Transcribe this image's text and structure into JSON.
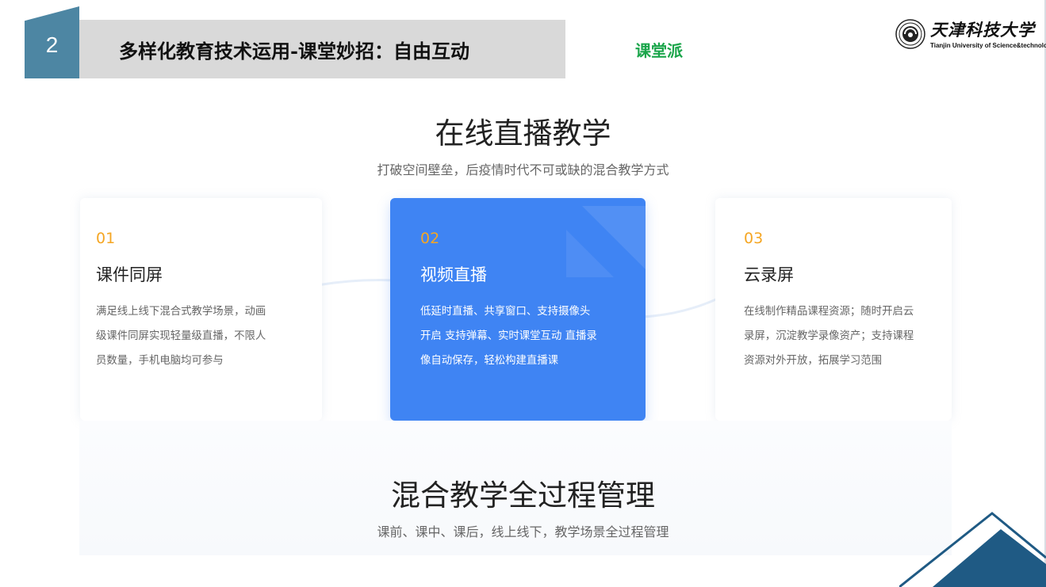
{
  "header": {
    "section_number": "2",
    "title": "多样化教育技术运用-课堂妙招：自由互动",
    "brand_tag": "课堂派"
  },
  "logo": {
    "name_cn": "天津科技大学",
    "name_en": "Tianjin University of Science&technology"
  },
  "section1": {
    "title": "在线直播教学",
    "subtitle": "打破空间壁垒，后疫情时代不可或缺的混合教学方式",
    "cards": [
      {
        "number": "01",
        "title": "课件同屏",
        "desc_lines": [
          "满足线上线下混合式教学场景，动画",
          "级课件同屏实现轻量级直播，不限人",
          "员数量，手机电脑均可参与"
        ]
      },
      {
        "number": "02",
        "title": "视频直播",
        "desc_lines": [
          "低延时直播、共享窗口、支持摄像头",
          "开启 支持弹幕、实时课堂互动 直播录",
          "像自动保存，轻松构建直播课"
        ]
      },
      {
        "number": "03",
        "title": "云录屏",
        "desc_lines": [
          "在线制作精品课程资源；随时开启云",
          "录屏，沉淀教学录像资产；支持课程",
          "资源对外开放，拓展学习范围"
        ]
      }
    ]
  },
  "section2": {
    "title": "混合教学全过程管理",
    "subtitle": "课前、课中、课后，线上线下，教学场景全过程管理"
  },
  "colors": {
    "badge": "#4d86a3",
    "title_bar": "#d9d9d9",
    "brand_green": "#1aa54a",
    "active_card": "#3f84f3",
    "card_number": "#f5a623",
    "corner_dark": "#1f5a84"
  },
  "icons": {
    "logo_seal": "university-seal-icon",
    "card_deco": "play-shape-icon",
    "corner": "triangle-decoration-icon"
  }
}
